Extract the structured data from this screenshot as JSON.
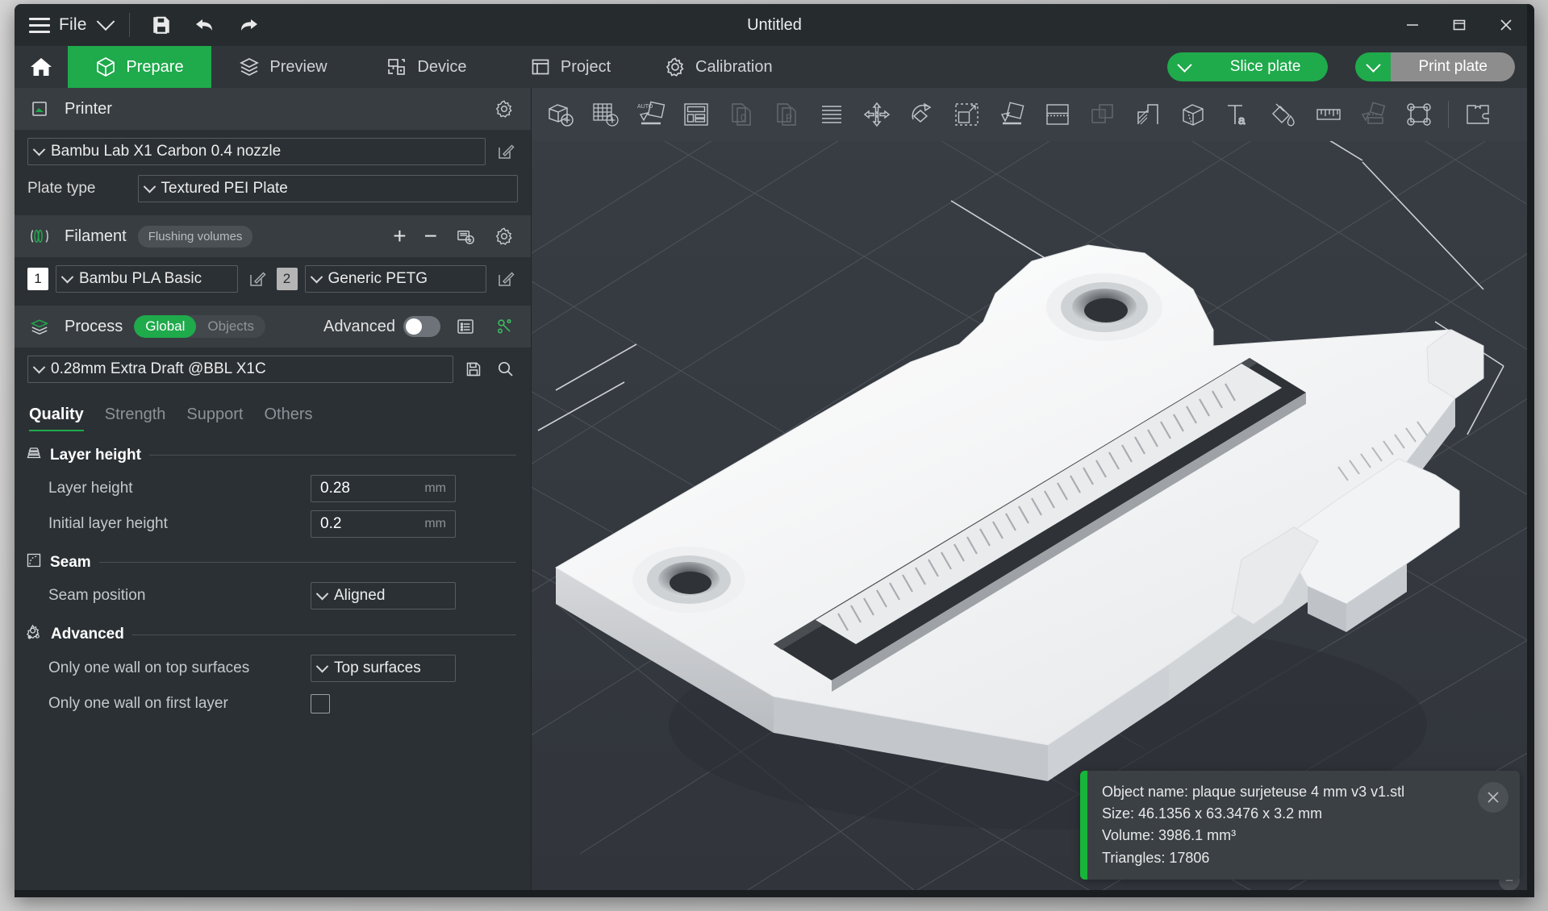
{
  "window": {
    "title": "Untitled",
    "minimize_label": "Minimize",
    "maximize_label": "Maximize",
    "close_label": "Close"
  },
  "titlebar": {
    "file_menu_label": "File",
    "save_icon": "save-icon",
    "undo_icon": "undo-icon",
    "redo_icon": "redo-icon",
    "menu_icon": "hamburger-icon",
    "dropdown_icon": "chevron-down-icon"
  },
  "topnav": {
    "home_icon": "home-icon",
    "items": [
      {
        "label": "Prepare",
        "icon": "cube-icon",
        "active": true
      },
      {
        "label": "Preview",
        "icon": "layers-icon",
        "active": false
      },
      {
        "label": "Device",
        "icon": "device-icon",
        "active": false
      },
      {
        "label": "Project",
        "icon": "project-icon",
        "active": false
      },
      {
        "label": "Calibration",
        "icon": "gear-icon",
        "active": false
      }
    ],
    "slice_plate_label": "Slice plate",
    "print_plate_label": "Print plate",
    "accent_green": "#1faa4b",
    "disabled_grey": "#8d8d8d"
  },
  "sidebar": {
    "printer": {
      "section_title": "Printer",
      "section_icon": "printer-icon",
      "settings_icon": "gear-icon",
      "printer_value": "Bambu Lab X1 Carbon 0.4 nozzle",
      "plate_type_label": "Plate type",
      "plate_type_value": "Textured PEI Plate",
      "edit_icon": "edit-icon"
    },
    "filament": {
      "section_title": "Filament",
      "section_icon": "filament-icon",
      "flushing_volumes_label": "Flushing volumes",
      "add_label": "+",
      "remove_label": "−",
      "sync_icon": "sync-filament-icon",
      "settings_icon": "gear-icon",
      "slots": [
        {
          "index": "1",
          "value": "Bambu PLA Basic",
          "selected": true
        },
        {
          "index": "2",
          "value": "Generic PETG",
          "selected": false
        }
      ]
    },
    "process": {
      "section_title": "Process",
      "section_icon": "process-icon",
      "scope_global": "Global",
      "scope_objects": "Objects",
      "advanced_label": "Advanced",
      "advanced_on": false,
      "list_icon": "list-view-icon",
      "compare_icon": "compare-presets-icon",
      "preset_value": "0.28mm Extra Draft @BBL X1C",
      "save_icon": "save-preset-icon",
      "search_icon": "search-icon"
    },
    "tabs": [
      {
        "label": "Quality",
        "active": true
      },
      {
        "label": "Strength",
        "active": false
      },
      {
        "label": "Support",
        "active": false
      },
      {
        "label": "Others",
        "active": false
      }
    ],
    "groups": [
      {
        "title": "Layer height",
        "icon": "layer-height-icon",
        "options": [
          {
            "label": "Layer height",
            "type": "number",
            "value": "0.28",
            "unit": "mm"
          },
          {
            "label": "Initial layer height",
            "type": "number",
            "value": "0.2",
            "unit": "mm"
          }
        ]
      },
      {
        "title": "Seam",
        "icon": "seam-icon",
        "options": [
          {
            "label": "Seam position",
            "type": "select",
            "value": "Aligned",
            "unit": ""
          }
        ]
      },
      {
        "title": "Advanced",
        "icon": "advanced-gears-icon",
        "options": [
          {
            "label": "Only one wall on top surfaces",
            "type": "select",
            "value": "Top surfaces",
            "unit": ""
          },
          {
            "label": "Only one wall on first layer",
            "type": "checkbox",
            "value": "",
            "checked": false,
            "unit": ""
          }
        ]
      }
    ]
  },
  "viewport": {
    "toolbar": [
      {
        "icon": "add-object-icon",
        "dim": false
      },
      {
        "icon": "add-plate-icon",
        "dim": false
      },
      {
        "icon": "auto-arrange-icon",
        "dim": false
      },
      {
        "icon": "arrange-layout-icon",
        "dim": false
      },
      {
        "icon": "copy-object-icon",
        "dim": true
      },
      {
        "icon": "paste-object-icon",
        "dim": true
      },
      {
        "icon": "variable-layer-height-icon",
        "dim": false
      },
      {
        "icon": "move-icon",
        "dim": false
      },
      {
        "icon": "rotate-icon",
        "dim": false
      },
      {
        "icon": "scale-icon",
        "dim": false
      },
      {
        "icon": "place-on-face-icon",
        "dim": false
      },
      {
        "icon": "cut-icon",
        "dim": false
      },
      {
        "icon": "mesh-boolean-icon",
        "dim": true
      },
      {
        "icon": "support-painting-icon",
        "dim": false
      },
      {
        "icon": "seam-painting-icon",
        "dim": false
      },
      {
        "icon": "text-emboss-icon",
        "dim": false
      },
      {
        "icon": "color-painting-icon",
        "dim": false
      },
      {
        "icon": "measure-icon",
        "dim": false
      },
      {
        "icon": "assembly-icon",
        "dim": true
      },
      {
        "icon": "simplify-mesh-icon",
        "dim": false
      },
      {
        "separator": true
      },
      {
        "icon": "assemble-view-icon",
        "dim": false
      }
    ],
    "object_info": {
      "name_line": "Object name: plaque surjeteuse 4 mm v3 v1.stl",
      "size_line": "Size: 46.1356 x 63.3476 x 3.2 mm",
      "volume_line": "Volume: 3986.1 mm³",
      "triangles_line": "Triangles: 17806",
      "close_icon": "close-icon",
      "collapse_icon": "minus-icon",
      "accent_bar_color": "#18b53b"
    }
  }
}
